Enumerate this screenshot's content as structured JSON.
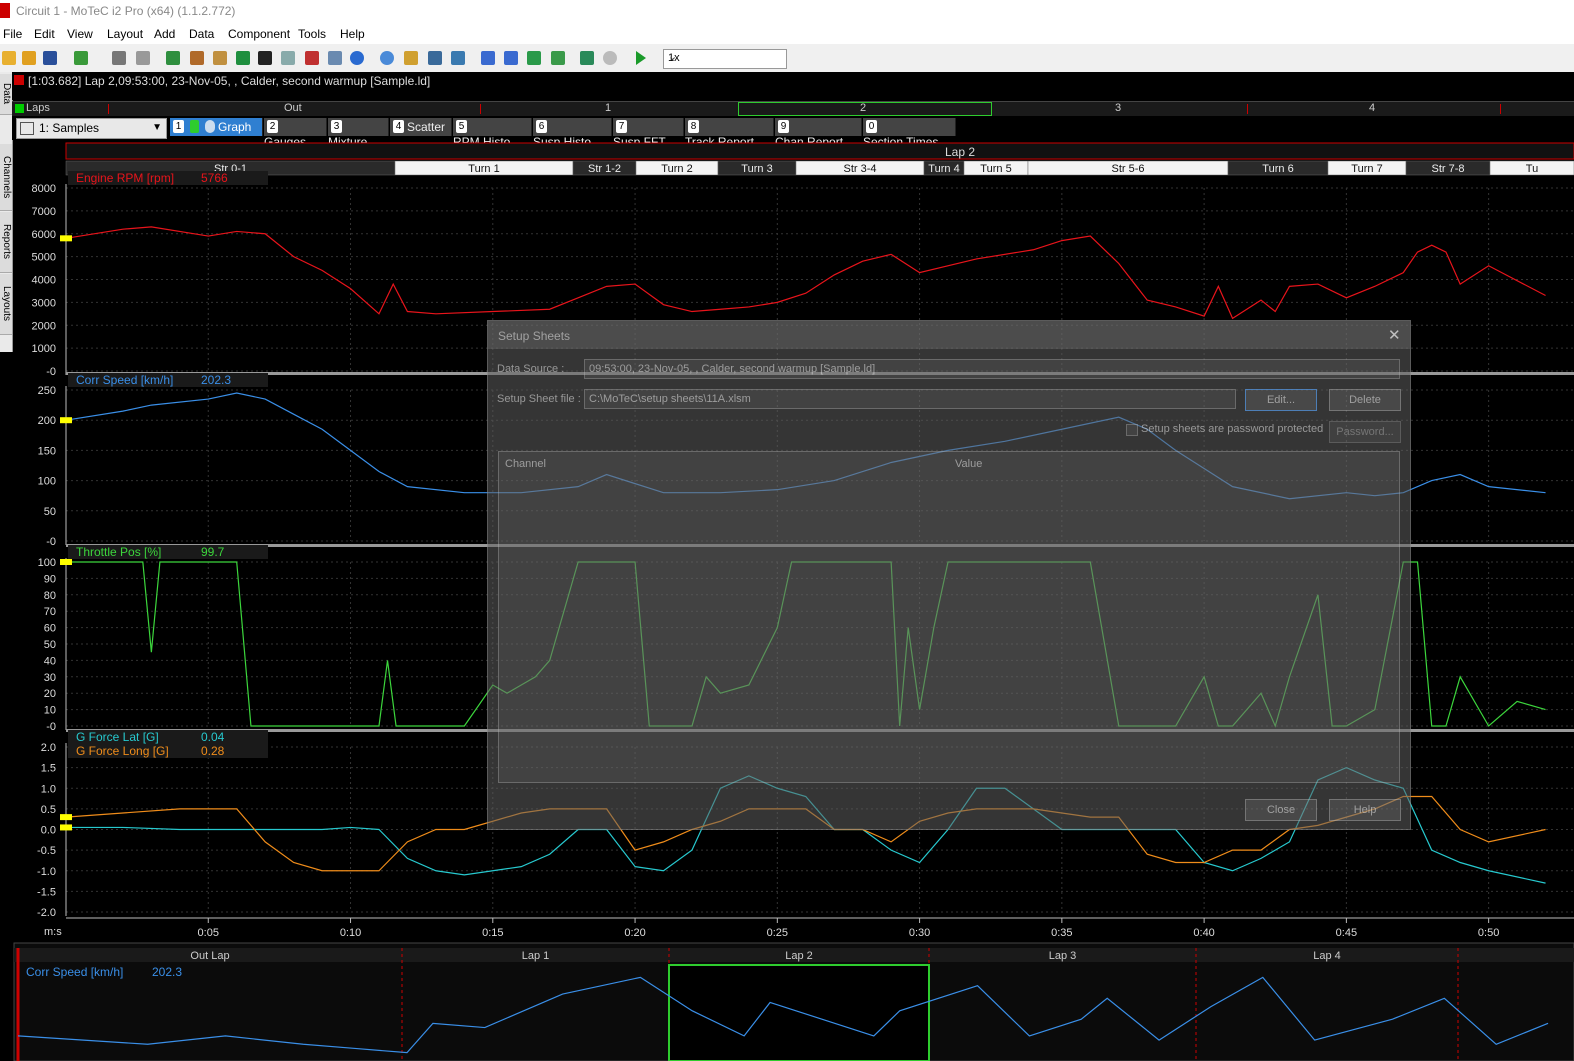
{
  "window": {
    "title": "Circuit 1 - MoTeC i2 Pro (x64) (1.1.2.772)"
  },
  "menu": [
    "File",
    "Edit",
    "View",
    "Layout",
    "Add",
    "Data",
    "Component",
    "Tools",
    "Help"
  ],
  "toolbar": {
    "playback_speed": "1x"
  },
  "info": {
    "text": "[1:03.682] Lap 2,09:53:00, 23-Nov-05, , Calder, second warmup [Sample.ld]"
  },
  "side_tabs": [
    "Data",
    "Channels",
    "Reports",
    "Layouts"
  ],
  "laps_bar": {
    "label": "Laps",
    "laps": [
      "Out",
      "1",
      "2",
      "3",
      "4"
    ],
    "selected": "2"
  },
  "worksheet": {
    "selector": "1: Samples",
    "tabs": [
      {
        "num": "1",
        "label": "Graph",
        "active": true
      },
      {
        "num": "2",
        "label": "Gauges"
      },
      {
        "num": "3",
        "label": "Mixture"
      },
      {
        "num": "4",
        "label": "Scatter"
      },
      {
        "num": "5",
        "label": "RPM Histo"
      },
      {
        "num": "6",
        "label": "Susp Histo"
      },
      {
        "num": "7",
        "label": "Susp FFT"
      },
      {
        "num": "8",
        "label": "Track Report"
      },
      {
        "num": "9",
        "label": "Chan Report"
      },
      {
        "num": "0",
        "label": "Section Times"
      }
    ]
  },
  "graph": {
    "lap_title": "Lap 2",
    "sections": [
      "Str 0-1",
      "Turn 1",
      "Str 1-2",
      "Turn 2",
      "Turn 3",
      "Str 3-4",
      "Turn 4",
      "Turn 5",
      "Str 5-6",
      "Turn 6",
      "Turn 7",
      "Str 7-8",
      "Tu"
    ],
    "x_unit": "m:s",
    "x_ticks": [
      "0:05",
      "0:10",
      "0:15",
      "0:20",
      "0:25",
      "0:30",
      "0:35",
      "0:40",
      "0:45",
      "0:50"
    ],
    "colors": {
      "rpm": "#e8141b",
      "speed": "#3a8fe8",
      "throttle": "#3cd63c",
      "glat": "#27c9cf",
      "glong": "#ef8c1a"
    }
  },
  "chart_data": [
    {
      "type": "line",
      "series": [
        {
          "name": "Engine RPM [rpm]",
          "current": "5766"
        }
      ],
      "x": [
        0,
        2,
        3,
        5,
        6,
        7,
        8,
        9,
        10,
        11,
        11.5,
        12,
        13,
        15,
        17,
        18,
        19,
        20,
        21,
        22,
        23,
        24,
        25,
        26,
        27,
        28,
        29,
        30,
        32,
        34,
        35,
        36,
        37,
        38,
        39,
        40,
        40.5,
        41,
        42,
        42.5,
        43,
        44,
        45,
        46,
        47,
        47.5,
        48,
        48.5,
        49,
        50,
        52
      ],
      "y": [
        5800,
        6200,
        6300,
        5900,
        6100,
        6000,
        5000,
        4400,
        3600,
        2500,
        3800,
        2600,
        2500,
        2600,
        2700,
        3200,
        3700,
        3800,
        2900,
        2600,
        2700,
        2800,
        3000,
        3400,
        4200,
        4800,
        5100,
        4300,
        4900,
        5300,
        5700,
        5900,
        4700,
        3100,
        2800,
        2400,
        3700,
        2300,
        3100,
        2600,
        3700,
        3800,
        3200,
        3700,
        4300,
        5200,
        5500,
        5200,
        3800,
        4600,
        3300
      ],
      "xlim": [
        0,
        53
      ],
      "ylim": [
        0,
        8000
      ],
      "y_ticks": [
        "8000",
        "7000",
        "6000",
        "5000",
        "4000",
        "3000",
        "2000",
        "1000",
        "-0"
      ]
    },
    {
      "type": "line",
      "series": [
        {
          "name": "Corr Speed [km/h]",
          "current": "202.3"
        }
      ],
      "x": [
        0,
        2,
        3,
        5,
        6,
        7,
        8,
        9,
        10,
        11,
        12,
        14,
        16,
        18,
        19,
        20,
        21,
        23,
        25,
        27,
        29,
        31,
        33,
        35,
        37,
        38,
        39,
        40,
        41,
        43,
        45,
        46,
        47,
        48,
        49,
        50,
        52
      ],
      "y": [
        200,
        215,
        225,
        235,
        245,
        235,
        210,
        185,
        150,
        115,
        90,
        80,
        80,
        90,
        110,
        95,
        80,
        80,
        85,
        100,
        130,
        150,
        165,
        185,
        205,
        185,
        150,
        120,
        90,
        70,
        80,
        75,
        80,
        100,
        110,
        90,
        80
      ],
      "xlim": [
        0,
        53
      ],
      "ylim": [
        0,
        250
      ],
      "y_ticks": [
        "250",
        "200",
        "150",
        "100",
        "50",
        "-0"
      ]
    },
    {
      "type": "line",
      "series": [
        {
          "name": "Throttle Pos [%]",
          "current": "99.7"
        }
      ],
      "x": [
        0,
        2.7,
        3,
        3.3,
        6,
        6.5,
        7,
        11,
        11.3,
        11.6,
        12,
        14,
        15,
        15.5,
        16,
        16.5,
        17,
        18,
        19,
        20,
        20.5,
        21,
        22,
        22.5,
        23,
        24,
        25,
        25.5,
        26,
        27,
        28.5,
        29,
        29.3,
        29.6,
        30,
        30.5,
        31,
        31.5,
        32,
        32.5,
        33,
        35,
        36,
        37,
        37.5,
        38,
        38.5,
        39,
        40,
        40.5,
        41,
        42,
        42.5,
        43,
        44,
        44.5,
        45,
        46,
        47,
        47.5,
        48,
        48.5,
        49,
        50,
        51,
        52
      ],
      "y": [
        100,
        100,
        45,
        100,
        100,
        0,
        0,
        0,
        40,
        0,
        0,
        0,
        25,
        20,
        25,
        30,
        40,
        100,
        100,
        100,
        0,
        0,
        0,
        30,
        20,
        25,
        60,
        100,
        100,
        100,
        100,
        100,
        0,
        60,
        10,
        60,
        100,
        100,
        100,
        100,
        100,
        100,
        100,
        0,
        0,
        0,
        0,
        0,
        30,
        0,
        0,
        20,
        0,
        30,
        80,
        0,
        0,
        10,
        100,
        100,
        0,
        0,
        30,
        0,
        15,
        10
      ],
      "xlim": [
        0,
        53
      ],
      "ylim": [
        0,
        100
      ],
      "y_ticks": [
        "100",
        "90",
        "80",
        "70",
        "60",
        "50",
        "40",
        "30",
        "20",
        "10",
        "-0"
      ]
    },
    {
      "type": "line",
      "series": [
        {
          "name": "G Force Lat [G]",
          "current": "0.04",
          "x": [
            0,
            2,
            4,
            6,
            7,
            8,
            9,
            10,
            11,
            12,
            13,
            14,
            15,
            16,
            17,
            18,
            19,
            20,
            21,
            22,
            23,
            24,
            25,
            26,
            27,
            28,
            29,
            30,
            31,
            32,
            33,
            34,
            35,
            36,
            37,
            38,
            39,
            40,
            41,
            42,
            43,
            44,
            45,
            46,
            47,
            48,
            49,
            50,
            52
          ],
          "y": [
            0.05,
            0.05,
            0.0,
            0.0,
            0.0,
            0.0,
            0.0,
            0.05,
            0.0,
            -0.7,
            -1.0,
            -1.1,
            -1.0,
            -0.9,
            -0.6,
            0.0,
            0.0,
            -0.9,
            -1.0,
            -0.5,
            1.0,
            1.3,
            1.0,
            0.8,
            0.0,
            0.0,
            -0.5,
            -0.8,
            0.0,
            1.0,
            1.0,
            0.5,
            0.0,
            0.0,
            0.0,
            0.0,
            0.0,
            -0.8,
            -1.0,
            -0.7,
            -0.3,
            1.2,
            1.5,
            1.2,
            1.0,
            -0.5,
            -0.8,
            -1.0,
            -1.3
          ]
        },
        {
          "name": "G Force Long [G]",
          "current": "0.28",
          "x": [
            0,
            2,
            4,
            6,
            7,
            8,
            9,
            10,
            11,
            12,
            13,
            14,
            15,
            16,
            17,
            18,
            19,
            20,
            21,
            22,
            23,
            24,
            25,
            26,
            27,
            28,
            29,
            30,
            31,
            32,
            33,
            34,
            35,
            36,
            37,
            38,
            39,
            40,
            41,
            42,
            43,
            44,
            45,
            46,
            47,
            48,
            49,
            50,
            52
          ],
          "y": [
            0.3,
            0.4,
            0.5,
            0.5,
            -0.3,
            -0.8,
            -1.0,
            -1.0,
            -1.0,
            -0.3,
            0.0,
            0.0,
            0.2,
            0.4,
            0.5,
            0.5,
            0.5,
            -0.5,
            -0.3,
            0.0,
            0.2,
            0.5,
            0.5,
            0.5,
            0.0,
            0.0,
            -0.3,
            0.2,
            0.4,
            0.5,
            0.5,
            0.5,
            0.4,
            0.3,
            0.3,
            -0.6,
            -0.8,
            -0.8,
            -0.5,
            -0.5,
            0.0,
            0.1,
            0.3,
            0.5,
            0.8,
            0.8,
            0.0,
            -0.3,
            0.0
          ]
        }
      ],
      "xlim": [
        0,
        53
      ],
      "ylim": [
        -2,
        2
      ],
      "y_ticks": [
        "2.0",
        "1.5",
        "1.0",
        "0.5",
        "0.0",
        "-0.5",
        "-1.0",
        "-1.5",
        "-2.0"
      ]
    },
    {
      "type": "line",
      "series": [
        {
          "name": "Corr Speed [km/h]",
          "current": "202.3"
        }
      ],
      "laps": [
        "Out Lap",
        "Lap 1",
        "Lap 2",
        "Lap 3",
        "Lap 4"
      ],
      "selected_lap": "Lap 2",
      "x": [
        0,
        5,
        8,
        11,
        13,
        15,
        16,
        18,
        21,
        24,
        26,
        28,
        29,
        31,
        33,
        34,
        37,
        39,
        41,
        42,
        44,
        46,
        48,
        50,
        53,
        55,
        57,
        59
      ],
      "y": [
        60,
        40,
        60,
        40,
        30,
        20,
        90,
        80,
        160,
        200,
        120,
        60,
        140,
        100,
        60,
        120,
        180,
        60,
        100,
        150,
        50,
        130,
        200,
        50,
        100,
        150,
        40,
        90
      ],
      "xlim": [
        0,
        60
      ],
      "ylim": [
        0,
        220
      ]
    }
  ],
  "setup_dialog": {
    "title": "Setup Sheets",
    "close": "✕",
    "data_source_label": "Data Source :",
    "data_source_value": "09:53:00, 23-Nov-05, , Calder, second warmup [Sample.ld]",
    "setup_file_label": "Setup Sheet file :",
    "setup_file_value": "C:\\MoTeC\\setup sheets\\11A.xlsm",
    "edit_button": "Edit...",
    "delete_button": "Delete",
    "password_checkbox": "Setup sheets are password protected",
    "password_button": "Password...",
    "col_channel": "Channel",
    "col_value": "Value",
    "close_button": "Close",
    "help_button": "Help"
  }
}
